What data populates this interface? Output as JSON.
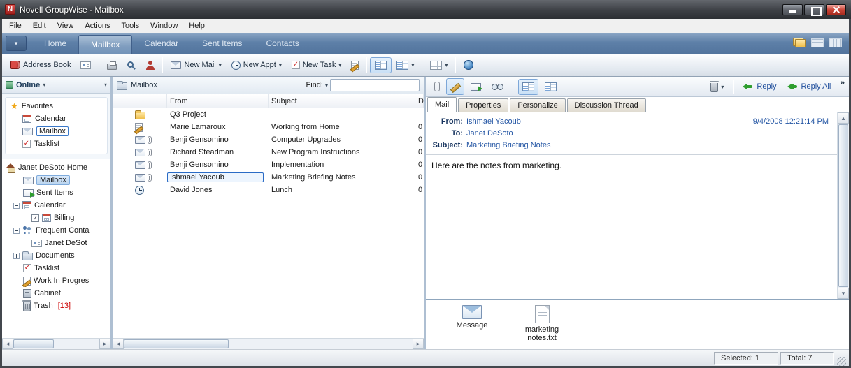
{
  "window": {
    "title": "Novell GroupWise - Mailbox"
  },
  "menubar": {
    "items": [
      "File",
      "Edit",
      "View",
      "Actions",
      "Tools",
      "Window",
      "Help"
    ]
  },
  "nav": {
    "tabs": [
      "Home",
      "Mailbox",
      "Calendar",
      "Sent Items",
      "Contacts"
    ],
    "active_tab": "Mailbox"
  },
  "toolbar": {
    "address_book_label": "Address Book",
    "new_mail_label": "New Mail",
    "new_appt_label": "New Appt",
    "new_task_label": "New Task"
  },
  "sidebar": {
    "account_label": "Online",
    "favorites_title": "Favorites",
    "favorites": [
      {
        "label": "Calendar"
      },
      {
        "label": "Mailbox"
      },
      {
        "label": "Tasklist"
      }
    ],
    "home_root": "Janet DeSoto Home",
    "tree": [
      {
        "label": "Mailbox"
      },
      {
        "label": "Sent Items"
      },
      {
        "label": "Calendar"
      },
      {
        "label": "Billing"
      },
      {
        "label": "Frequent Conta"
      },
      {
        "label": "Janet DeSot"
      },
      {
        "label": "Documents"
      },
      {
        "label": "Tasklist"
      },
      {
        "label": "Work In Progres"
      },
      {
        "label": "Cabinet"
      },
      {
        "label": "Trash",
        "badge": "[13]"
      }
    ]
  },
  "list": {
    "title": "Mailbox",
    "find_label": "Find:",
    "find_value": "",
    "columns": {
      "from": "From",
      "subject": "Subject",
      "date": "D"
    },
    "rows": [
      {
        "from": "Q3 Project",
        "subject": "",
        "d": ""
      },
      {
        "from": "Marie Lamaroux",
        "subject": "Working from Home",
        "d": "0"
      },
      {
        "from": "Benji Gensomino",
        "subject": "Computer Upgrades",
        "d": "0"
      },
      {
        "from": "Richard Steadman",
        "subject": "New Program Instructions",
        "d": "0"
      },
      {
        "from": "Benji Gensomino",
        "subject": "Implementation",
        "d": "0"
      },
      {
        "from": "Ishmael Yacoub",
        "subject": "Marketing Briefing Notes",
        "d": "0"
      },
      {
        "from": "David Jones",
        "subject": "Lunch",
        "d": "0"
      }
    ]
  },
  "preview": {
    "reply_label": "Reply",
    "reply_all_label": "Reply All",
    "overflow": "»",
    "tabs": [
      "Mail",
      "Properties",
      "Personalize",
      "Discussion Thread"
    ],
    "active_tab": "Mail",
    "from_label": "From:",
    "from_value": "Ishmael Yacoub",
    "date": "9/4/2008 12:21:14 PM",
    "to_label": "To:",
    "to_value": "Janet DeSoto",
    "subject_label": "Subject:",
    "subject_value": "Marketing Briefing Notes",
    "body": "Here are the notes from marketing.",
    "attachments": [
      {
        "label": "Message"
      },
      {
        "label": "marketing notes.txt"
      }
    ]
  },
  "statusbar": {
    "selected": "Selected: 1",
    "total": "Total: 7"
  },
  "icons": {
    "star": "★",
    "check": "✓",
    "dropdown": "▾",
    "scroll_left": "◂",
    "scroll_right": "▸",
    "scroll_up": "▴",
    "scroll_down": "▾"
  }
}
